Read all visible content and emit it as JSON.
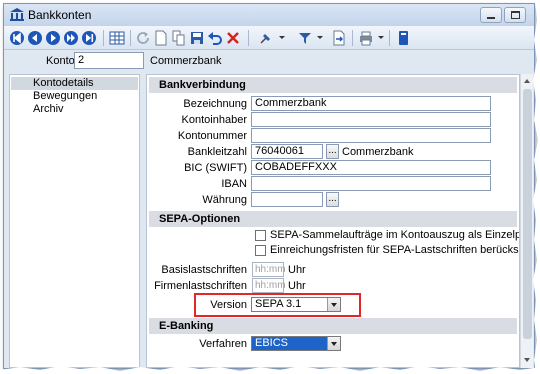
{
  "window": {
    "title": "Bankkonten"
  },
  "toolbar": {
    "icons": [
      "first-icon",
      "previous-icon",
      "next-icon",
      "last-icon",
      "grid-icon",
      "refresh-icon",
      "new-icon",
      "copy-icon",
      "save-icon",
      "undo-icon",
      "delete-icon",
      "pin-icon",
      "filter-icon",
      "export-icon",
      "print-icon",
      "info-icon"
    ]
  },
  "konto": {
    "label": "Konto",
    "value": "2",
    "name": "Commerzbank"
  },
  "sidebar": {
    "items": [
      {
        "label": "Kontodetails",
        "active": true
      },
      {
        "label": "Bewegungen",
        "active": false
      },
      {
        "label": "Archiv",
        "active": false
      }
    ]
  },
  "bankverbindung": {
    "title": "Bankverbindung",
    "bezeichnung_label": "Bezeichnung",
    "bezeichnung_value": "Commerzbank",
    "kontoinhaber_label": "Kontoinhaber",
    "kontoinhaber_value": "",
    "kontonummer_label": "Kontonummer",
    "kontonummer_value": "",
    "bankleitzahl_label": "Bankleitzahl",
    "bankleitzahl_value": "76040061",
    "bankleitzahl_bank": "Commerzbank",
    "bic_label": "BIC (SWIFT)",
    "bic_value": "COBADEFFXXX",
    "iban_label": "IBAN",
    "iban_value": "",
    "waehrung_label": "Währung",
    "waehrung_value": "",
    "dots": "..."
  },
  "sepa": {
    "title": "SEPA-Optionen",
    "option1": "SEPA-Sammelaufträge im Kontoauszug als Einzelposten buchen",
    "option2": "Einreichungsfristen für SEPA-Lastschriften berücksichtigen",
    "basis_label": "Basislastschriften",
    "firmen_label": "Firmenlastschriften",
    "time_placeholder": "hh:mm",
    "uhr": "Uhr",
    "version_label": "Version",
    "version_value": "SEPA 3.1"
  },
  "ebanking": {
    "title": "E-Banking",
    "verfahren_label": "Verfahren",
    "verfahren_value": "EBICS"
  },
  "colors": {
    "highlight": "#e2262a",
    "selection": "#1e64c8",
    "title_bar": "#c3d4ea",
    "section": "#d9dde3"
  }
}
